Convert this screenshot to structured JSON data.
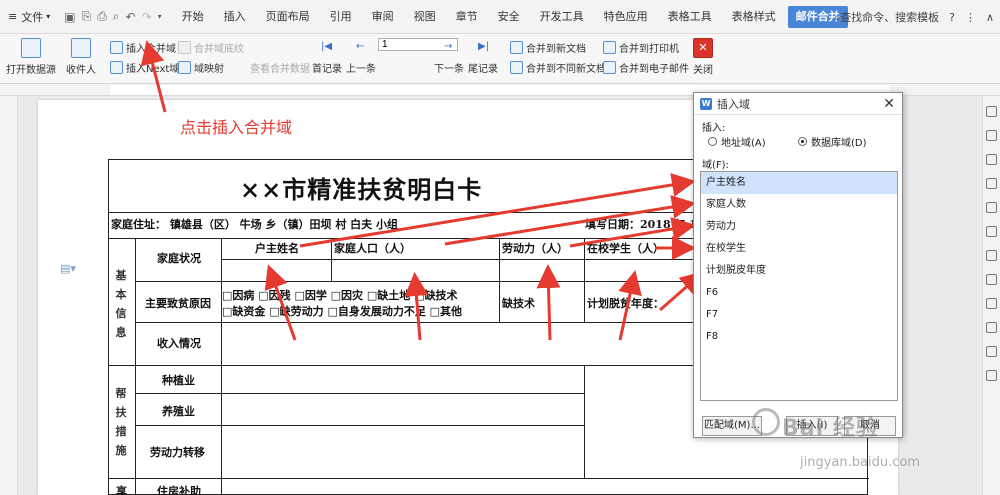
{
  "menubar": {
    "file": "文件",
    "tabs": [
      "开始",
      "插入",
      "页面布局",
      "引用",
      "审阅",
      "视图",
      "章节",
      "安全",
      "开发工具",
      "特色应用",
      "表格工具",
      "表格样式",
      "邮件合并"
    ],
    "search": "查找命令、搜索模板",
    "help": "?"
  },
  "ribbon": {
    "open_source": "打开数据源",
    "recipient": "收件人",
    "insert_merge_field": "插入合并域",
    "merge_field_shading": "合并域底纹",
    "insert_next_field": "插入Next域",
    "field_map": "域映射",
    "view_merged_data": "查看合并数据",
    "first_record": "首记录",
    "prev": "上一条",
    "record_value": "1",
    "next": "下一条",
    "last_record": "尾记录",
    "merge_new_doc": "合并到新文档",
    "merge_diff_docs": "合并到不同新文档",
    "merge_printer": "合并到打印机",
    "merge_email": "合并到电子邮件",
    "close": "关闭"
  },
  "annotation": "点击插入合并域",
  "document": {
    "title": "××市精准扶贫明白卡",
    "address_row": "家庭住址： 镇雄县（区） 牛场 乡（镇）田坝 村        白夫      小组",
    "fill_date": "填写日期：2018 年  1",
    "basic_info": "基本信息",
    "family_status": "家庭状况",
    "col_head": "户主姓名",
    "col_pop": "家庭人口（人）",
    "col_labor": "劳动力（人）",
    "col_students": "在校学生（人）",
    "poverty_cause": "主要致贫原因",
    "causes_line1": "□因病  □因残  □因学  □因灾  □缺土地  □缺技术",
    "causes_line2": "□缺资金  □缺劳动力  □自身发展动力不足  □其他",
    "lack_tech": "缺技术",
    "plan_year": "计划脱贫年度：",
    "income": "收入情况",
    "help_measures": "帮扶措施",
    "planting": "种植业",
    "breeding": "养殖业",
    "labor_transfer": "劳动力转移",
    "housing": "住房补助",
    "next_section": "享"
  },
  "dialog": {
    "title": "插入域",
    "insert_label": "插入:",
    "radio_address": "地址域(A)",
    "radio_db": "数据库域(D)",
    "fields_label": "域(F):",
    "fields": [
      "户主姓名",
      "家庭人数",
      "劳动力",
      "在校学生",
      "计划脱皮年度",
      "F6",
      "F7",
      "F8"
    ],
    "match_button": "匹配域(M)...",
    "insert_button": "插入(I)",
    "cancel_button": "取消"
  },
  "watermark": {
    "brand": "Bai 经验",
    "url": "jingyan.baidu.com"
  },
  "colors": {
    "accent_tab": "#4a86d8",
    "annotation_red": "#e53a30",
    "selection": "#cfe3fa"
  }
}
